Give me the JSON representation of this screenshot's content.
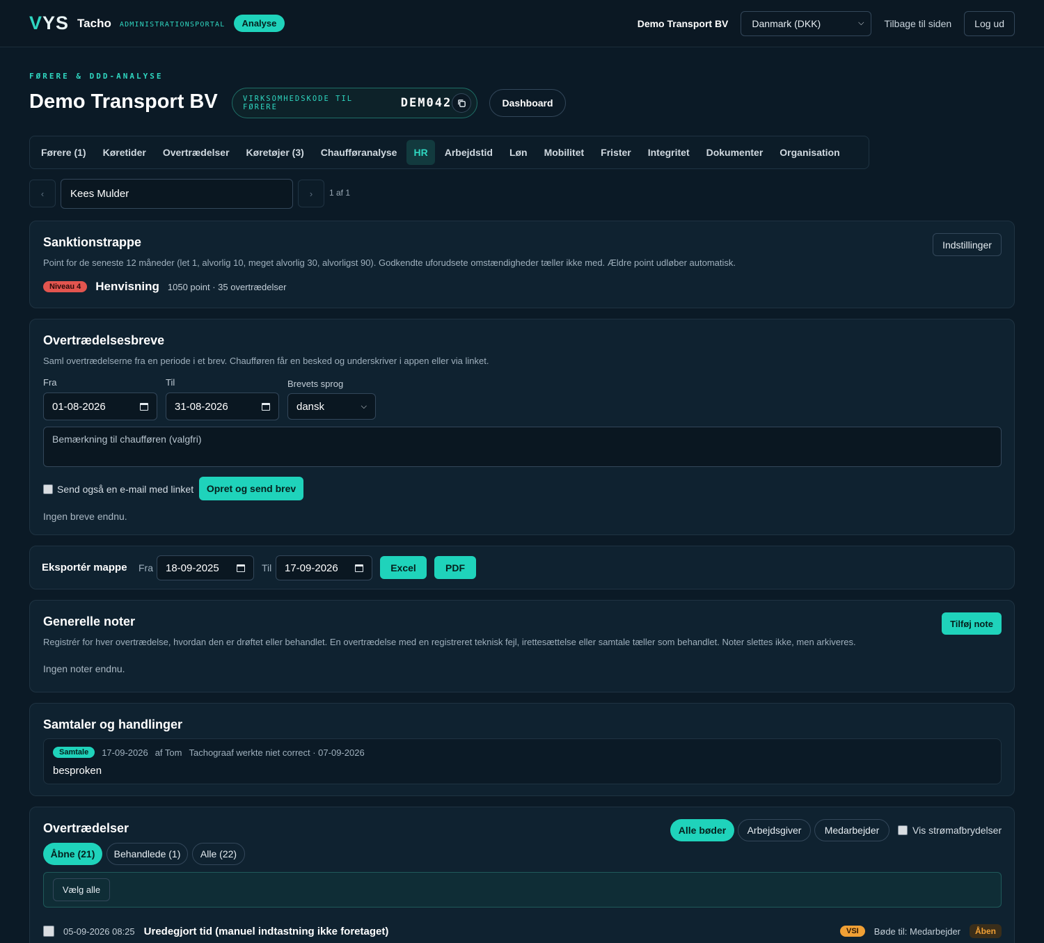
{
  "topbar": {
    "logo_mark_v": "V",
    "logo_mark_ys": "YS",
    "app_name": "Tacho",
    "app_sub": "ADMINISTRATIONSPORTAL",
    "mode_badge": "Analyse",
    "company": "Demo Transport BV",
    "region_select": "Danmark (DKK)",
    "back_link": "Tilbage til siden",
    "logout": "Log ud"
  },
  "header": {
    "eyebrow": "FØRERE & DDD-ANALYSE",
    "title": "Demo Transport BV",
    "code_label": "VIRKSOMHEDSKODE TIL FØRERE",
    "code_value": "DEM042",
    "dashboard_button": "Dashboard"
  },
  "tabs": [
    {
      "label": "Førere (1)"
    },
    {
      "label": "Køretider"
    },
    {
      "label": "Overtrædelser"
    },
    {
      "label": "Køretøjer (3)"
    },
    {
      "label": "Chaufføranalyse"
    },
    {
      "label": "HR",
      "active": true
    },
    {
      "label": "Arbejdstid"
    },
    {
      "label": "Løn"
    },
    {
      "label": "Mobilitet"
    },
    {
      "label": "Frister"
    },
    {
      "label": "Integritet"
    },
    {
      "label": "Dokumenter"
    },
    {
      "label": "Organisation"
    }
  ],
  "driver_selector": {
    "prev": "‹",
    "next": "›",
    "driver": "Kees Mulder",
    "pager": "1 af 1"
  },
  "sanction": {
    "title": "Sanktionstrappe",
    "description": "Point for de seneste 12 måneder (let 1, alvorlig 10, meget alvorlig 30, alvorligst 90). Godkendte uforudsete omstændigheder tæller ikke med. Ældre point udløber automatisk.",
    "level_badge": "Niveau 4",
    "level_name": "Henvisning",
    "summary": "1050 point · 35 overtrædelser",
    "settings_button": "Indstillinger"
  },
  "letters": {
    "title": "Overtrædelsesbreve",
    "description": "Saml overtrædelserne fra en periode i et brev. Chaufføren får en besked og underskriver i appen eller via linket.",
    "from_label": "Fra",
    "from_value": "01-08-2026",
    "to_label": "Til",
    "to_value": "31-08-2026",
    "language_label": "Brevets sprog",
    "language_value": "dansk",
    "note_placeholder": "Bemærkning til chaufføren (valgfri)",
    "email_checkbox_label": "Send også en e-mail med linket",
    "create_button": "Opret og send brev",
    "empty_text": "Ingen breve endnu."
  },
  "export": {
    "title": "Eksportér mappe",
    "from_label": "Fra",
    "from_value": "18-09-2025",
    "to_label": "Til",
    "to_value": "17-09-2026",
    "excel_button": "Excel",
    "pdf_button": "PDF"
  },
  "notes": {
    "title": "Generelle noter",
    "description": "Registrér for hver overtrædelse, hvordan den er drøftet eller behandlet. En overtrædelse med en registreret teknisk fejl, irettesættelse eller samtale tæller som behandlet. Noter slettes ikke, men arkiveres.",
    "add_button": "Tilføj note",
    "empty_text": "Ingen noter endnu."
  },
  "conversations": {
    "title": "Samtaler og handlinger",
    "items": [
      {
        "type_badge": "Samtale",
        "date": "17-09-2026",
        "author": "af Tom",
        "subject": "Tachograaf werkte niet correct · 07-09-2026",
        "text": "besproken"
      }
    ]
  },
  "violations": {
    "title": "Overtrædelser",
    "filter_all_fines": "Alle bøder",
    "filter_employer": "Arbejdsgiver",
    "filter_employee": "Medarbejder",
    "show_power_label": "Vis strømafbrydelser",
    "tab_open": "Åbne (21)",
    "tab_handled": "Behandlede (1)",
    "tab_all": "Alle (22)",
    "select_all": "Vælg alle",
    "rows": [
      {
        "datetime": "05-09-2026 08:25",
        "title": "Uredegjort tid (manuel indtastning ikke foretaget)",
        "severity_badge": "VSI",
        "fine_to": "Bøde til: Medarbejder",
        "status": "Åben"
      }
    ]
  },
  "colors": {
    "accent": "#1fd3bb",
    "background": "#0b1a26",
    "danger": "#e2554f",
    "warning": "#f0a035"
  }
}
